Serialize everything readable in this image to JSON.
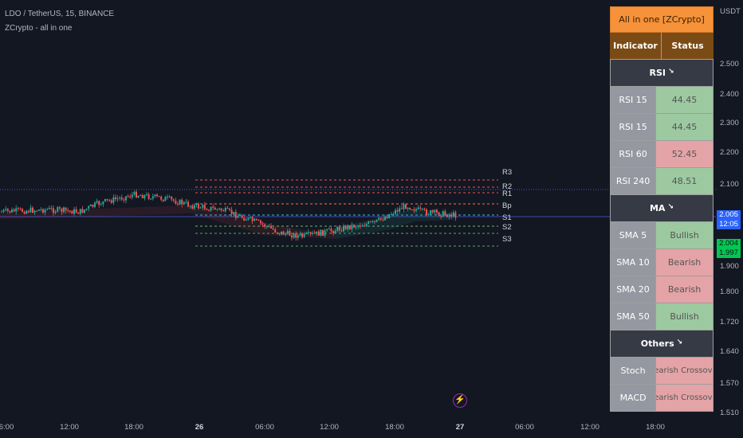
{
  "header": {
    "symbol": "LDO / TetherUS, 15, BINANCE",
    "indicator": "ZCrypto - all in one"
  },
  "price_axis": {
    "currency": "USDT",
    "labels": [
      "2.500",
      "2.400",
      "2.300",
      "2.200",
      "2.100",
      "1.900",
      "1.800",
      "1.720",
      "1.640",
      "1.570",
      "1.510"
    ],
    "current_price": "2.005",
    "countdown": "12:05",
    "badge_high": "2.004",
    "badge_low": "1.997"
  },
  "time_axis": [
    "6:00",
    "12:00",
    "18:00",
    "26",
    "06:00",
    "12:00",
    "18:00",
    "27",
    "06:00",
    "12:00",
    "18:00"
  ],
  "pivot_levels": [
    "R3",
    "R2",
    "R1",
    "Bp",
    "S1",
    "S2",
    "S3"
  ],
  "table": {
    "title": "All in one [ZCrypto]",
    "header": {
      "indicator": "Indicator",
      "status": "Status"
    },
    "sections": [
      {
        "name": "RSI",
        "arrow": "↘",
        "rows": [
          {
            "name": "RSI 15",
            "value": "44.45",
            "color": "green"
          },
          {
            "name": "RSI 15",
            "value": "44.45",
            "color": "green"
          },
          {
            "name": "RSI 60",
            "value": "52.45",
            "color": "red"
          },
          {
            "name": "RSI 240",
            "value": "48.51",
            "color": "green"
          }
        ]
      },
      {
        "name": "MA",
        "arrow": "↘",
        "rows": [
          {
            "name": "SMA 5",
            "value": "Bullish",
            "color": "green"
          },
          {
            "name": "SMA 10",
            "value": "Bearish",
            "color": "red"
          },
          {
            "name": "SMA 20",
            "value": "Bearish",
            "color": "red"
          },
          {
            "name": "SMA 50",
            "value": "Bullish",
            "color": "green"
          }
        ]
      },
      {
        "name": "Others",
        "arrow": "↘",
        "rows": [
          {
            "name": "Stoch",
            "value": "Bearish Crossover",
            "color": "red"
          },
          {
            "name": "MACD",
            "value": "Bearish Crossover",
            "color": "red"
          }
        ]
      }
    ]
  },
  "colors": {
    "background": "#131722",
    "bull": "#26a69a",
    "bear": "#ef5350",
    "title_bg": "#f5923a",
    "header_bg": "#7b4b16",
    "price_tag": "#2962ff",
    "badge_green": "#00c853"
  },
  "icons": {
    "flash": "lightning-icon",
    "arrow": "arrow-down-right-icon"
  }
}
